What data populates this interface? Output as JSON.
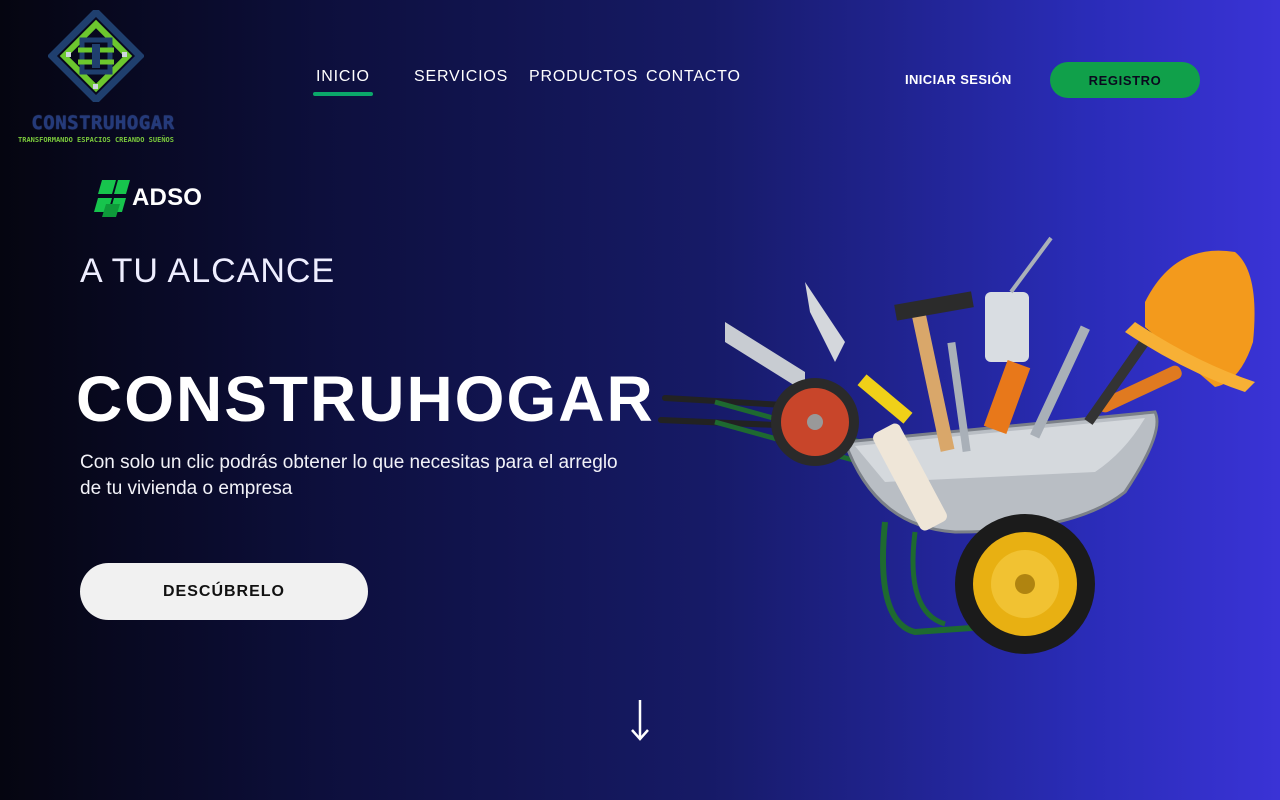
{
  "brand": {
    "name": "CONSTRUHOGAR",
    "tagline": "TRANSFORMANDO ESPACIOS CREANDO SUEÑOS",
    "logo_icon": "house-knot-logo-icon"
  },
  "nav": {
    "items": [
      {
        "label": "INICIO",
        "active": true
      },
      {
        "label": "SERVICIOS",
        "active": false
      },
      {
        "label": "PRODUCTOS",
        "active": false
      },
      {
        "label": "CONTACTO",
        "active": false
      }
    ],
    "login_label": "INICIAR SESIÓN",
    "register_label": "REGISTRO"
  },
  "badge": {
    "label": "ADSO",
    "icon": "adso-logo-icon"
  },
  "hero": {
    "kicker": "A TU ALCANCE",
    "title": "CONSTRUHOGAR",
    "description": "Con solo un clic podrás obtener lo que necesitas para el arreglo de tu vivienda o empresa",
    "cta_label": "DESCÚBRELO",
    "image": "wheelbarrow-with-tools-illustration",
    "scroll_icon": "arrow-down-icon"
  },
  "colors": {
    "accent_green": "#10a04a",
    "nav_underline": "#0ba86a",
    "bg_start": "#050510",
    "bg_end": "#3a33d6",
    "button_light": "#f1f1f1"
  }
}
